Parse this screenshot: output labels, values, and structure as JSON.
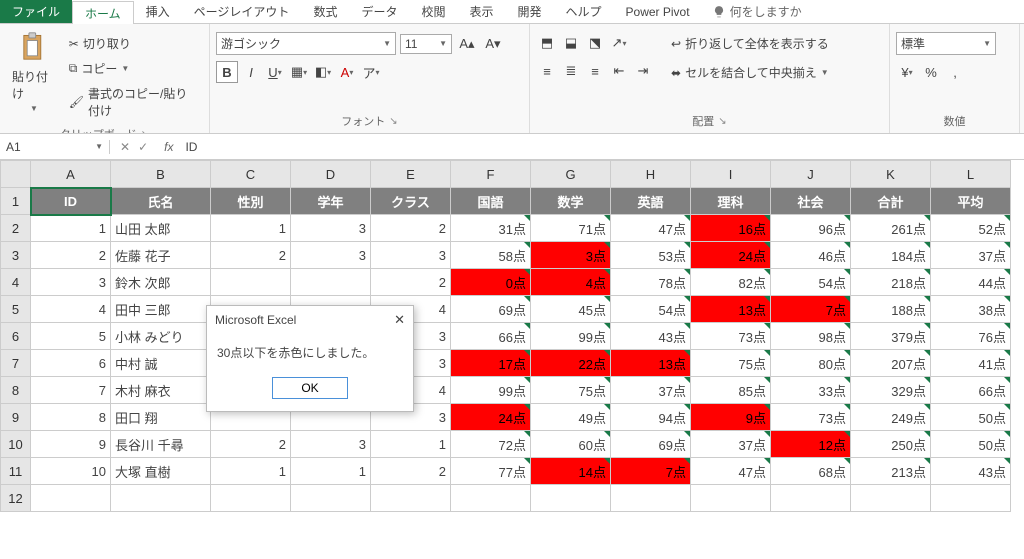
{
  "menu": {
    "file": "ファイル",
    "home": "ホーム",
    "insert": "挿入",
    "pagelayout": "ページレイアウト",
    "formulas": "数式",
    "data": "データ",
    "review": "校閲",
    "view": "表示",
    "developer": "開発",
    "help": "ヘルプ",
    "powerpivot": "Power Pivot",
    "tellme": "何をしますか"
  },
  "ribbon": {
    "clipboard": {
      "paste": "貼り付け",
      "cut": "切り取り",
      "copy": "コピー",
      "fmtpaint": "書式のコピー/貼り付け",
      "title": "クリップボード"
    },
    "font": {
      "name": "游ゴシック",
      "size": "11",
      "title": "フォント"
    },
    "align": {
      "wrap": "折り返して全体を表示する",
      "merge": "セルを結合して中央揃え",
      "title": "配置"
    },
    "number": {
      "fmt": "標準",
      "title": "数値"
    }
  },
  "fbar": {
    "name": "A1",
    "formula": "ID"
  },
  "cols": [
    "A",
    "B",
    "C",
    "D",
    "E",
    "F",
    "G",
    "H",
    "I",
    "J",
    "K",
    "L"
  ],
  "hdr": [
    "ID",
    "氏名",
    "性別",
    "学年",
    "クラス",
    "国語",
    "数学",
    "英語",
    "理科",
    "社会",
    "合計",
    "平均"
  ],
  "rows": [
    {
      "n": 2,
      "id": "1",
      "name": "山田 太郎",
      "sex": "1",
      "grade": "3",
      "class": "2",
      "ja": "31点",
      "ma": "71点",
      "en": "47点",
      "sc": "16点",
      "so": "96点",
      "sum": "261点",
      "avg": "52点",
      "red": [
        "sc"
      ]
    },
    {
      "n": 3,
      "id": "2",
      "name": "佐藤 花子",
      "sex": "2",
      "grade": "3",
      "class": "3",
      "ja": "58点",
      "ma": "3点",
      "en": "53点",
      "sc": "24点",
      "so": "46点",
      "sum": "184点",
      "avg": "37点",
      "red": [
        "ma",
        "sc"
      ]
    },
    {
      "n": 4,
      "id": "3",
      "name": "鈴木 次郎",
      "sex": "",
      "grade": "",
      "class": "2",
      "ja": "0点",
      "ma": "4点",
      "en": "78点",
      "sc": "82点",
      "so": "54点",
      "sum": "218点",
      "avg": "44点",
      "red": [
        "ja",
        "ma"
      ]
    },
    {
      "n": 5,
      "id": "4",
      "name": "田中 三郎",
      "sex": "",
      "grade": "",
      "class": "4",
      "ja": "69点",
      "ma": "45点",
      "en": "54点",
      "sc": "13点",
      "so": "7点",
      "sum": "188点",
      "avg": "38点",
      "red": [
        "sc",
        "so"
      ]
    },
    {
      "n": 6,
      "id": "5",
      "name": "小林 みどり",
      "sex": "",
      "grade": "",
      "class": "3",
      "ja": "66点",
      "ma": "99点",
      "en": "43点",
      "sc": "73点",
      "so": "98点",
      "sum": "379点",
      "avg": "76点",
      "red": []
    },
    {
      "n": 7,
      "id": "6",
      "name": "中村 誠",
      "sex": "",
      "grade": "",
      "class": "3",
      "ja": "17点",
      "ma": "22点",
      "en": "13点",
      "sc": "75点",
      "so": "80点",
      "sum": "207点",
      "avg": "41点",
      "red": [
        "ja",
        "ma",
        "en"
      ]
    },
    {
      "n": 8,
      "id": "7",
      "name": "木村 麻衣",
      "sex": "",
      "grade": "",
      "class": "4",
      "ja": "99点",
      "ma": "75点",
      "en": "37点",
      "sc": "85点",
      "so": "33点",
      "sum": "329点",
      "avg": "66点",
      "red": []
    },
    {
      "n": 9,
      "id": "8",
      "name": "田口 翔",
      "sex": "",
      "grade": "",
      "class": "3",
      "ja": "24点",
      "ma": "49点",
      "en": "94点",
      "sc": "9点",
      "so": "73点",
      "sum": "249点",
      "avg": "50点",
      "red": [
        "ja",
        "sc"
      ]
    },
    {
      "n": 10,
      "id": "9",
      "name": "長谷川 千尋",
      "sex": "2",
      "grade": "3",
      "class": "1",
      "ja": "72点",
      "ma": "60点",
      "en": "69点",
      "sc": "37点",
      "so": "12点",
      "sum": "250点",
      "avg": "50点",
      "red": [
        "so"
      ]
    },
    {
      "n": 11,
      "id": "10",
      "name": "大塚 直樹",
      "sex": "1",
      "grade": "1",
      "class": "2",
      "ja": "77点",
      "ma": "14点",
      "en": "7点",
      "sc": "47点",
      "so": "68点",
      "sum": "213点",
      "avg": "43点",
      "red": [
        "ma",
        "en"
      ]
    }
  ],
  "dialog": {
    "title": "Microsoft Excel",
    "body": "30点以下を赤色にしました。",
    "ok": "OK"
  },
  "chart_data": {
    "type": "table",
    "title": "30点以下を赤色にしました。",
    "columns": [
      "ID",
      "氏名",
      "性別",
      "学年",
      "クラス",
      "国語",
      "数学",
      "英語",
      "理科",
      "社会",
      "合計",
      "平均"
    ],
    "rows": [
      [
        1,
        "山田 太郎",
        1,
        3,
        2,
        31,
        71,
        47,
        16,
        96,
        261,
        52
      ],
      [
        2,
        "佐藤 花子",
        2,
        3,
        3,
        58,
        3,
        53,
        24,
        46,
        184,
        37
      ],
      [
        3,
        "鈴木 次郎",
        null,
        null,
        2,
        0,
        4,
        78,
        82,
        54,
        218,
        44
      ],
      [
        4,
        "田中 三郎",
        null,
        null,
        4,
        69,
        45,
        54,
        13,
        7,
        188,
        38
      ],
      [
        5,
        "小林 みどり",
        null,
        null,
        3,
        66,
        99,
        43,
        73,
        98,
        379,
        76
      ],
      [
        6,
        "中村 誠",
        null,
        null,
        3,
        17,
        22,
        13,
        75,
        80,
        207,
        41
      ],
      [
        7,
        "木村 麻衣",
        null,
        null,
        4,
        99,
        75,
        37,
        85,
        33,
        329,
        66
      ],
      [
        8,
        "田口 翔",
        null,
        null,
        3,
        24,
        49,
        94,
        9,
        73,
        249,
        50
      ],
      [
        9,
        "長谷川 千尋",
        2,
        3,
        1,
        72,
        60,
        69,
        37,
        12,
        250,
        50
      ],
      [
        10,
        "大塚 直樹",
        1,
        1,
        2,
        77,
        14,
        7,
        47,
        68,
        213,
        43
      ]
    ],
    "highlight_rule": "value<=30"
  }
}
